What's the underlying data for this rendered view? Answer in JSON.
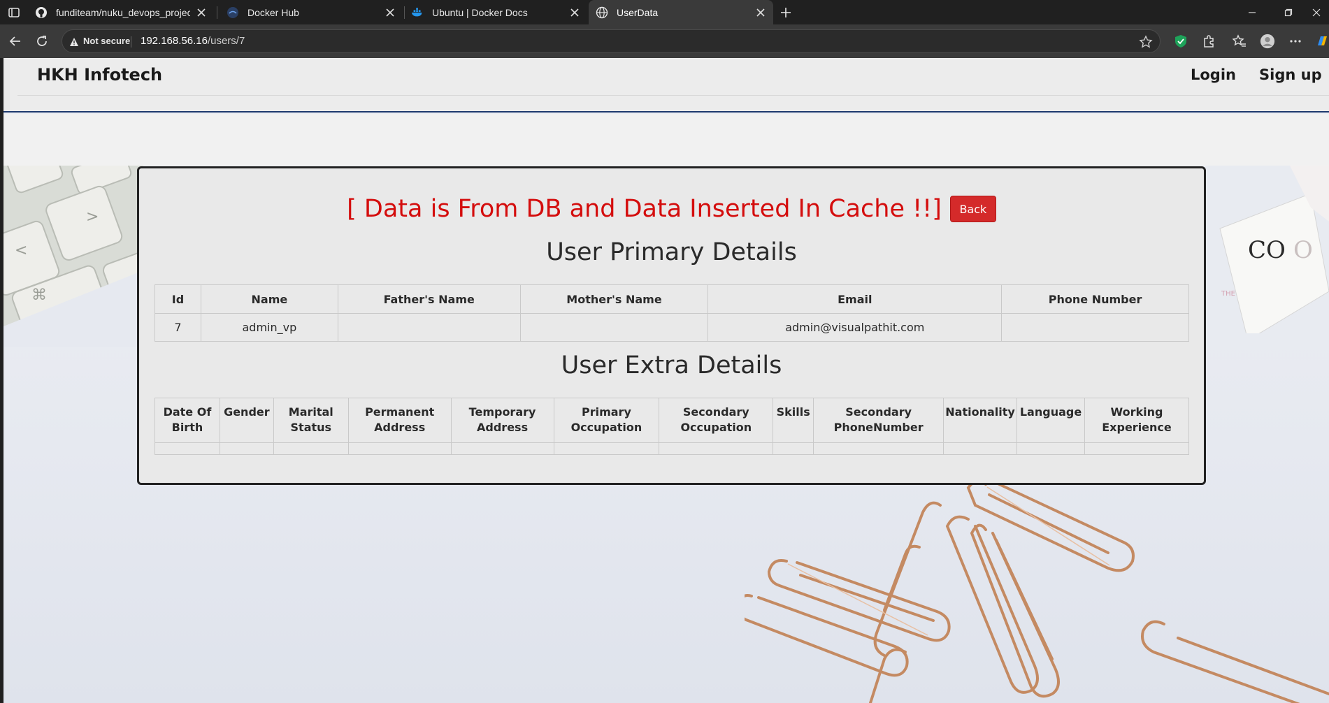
{
  "browser": {
    "tabs": [
      {
        "title": "funditeam/nuku_devops_projects",
        "icon": "github-icon",
        "active": false
      },
      {
        "title": "Docker Hub",
        "icon": "docker-hub-icon",
        "active": false
      },
      {
        "title": "Ubuntu | Docker Docs",
        "icon": "docker-icon",
        "active": false
      },
      {
        "title": "UserData",
        "icon": "globe-icon",
        "active": true
      }
    ],
    "security_label": "Not secure",
    "url_host": "192.168.56.16",
    "url_path": "/users/7"
  },
  "site": {
    "brand": "HKH Infotech",
    "nav": {
      "login": "Login",
      "signup": "Sign up"
    }
  },
  "card": {
    "banner": "[ Data is From DB and Data Inserted In Cache !!]",
    "back_label": "Back",
    "primary_title": "User Primary Details",
    "extra_title": "User Extra Details"
  },
  "primary_table": {
    "headers": [
      "Id",
      "Name",
      "Father's Name",
      "Mother's Name",
      "Email",
      "Phone Number"
    ],
    "rows": [
      [
        "7",
        "admin_vp",
        "",
        "",
        "admin@visualpathit.com",
        ""
      ]
    ]
  },
  "extra_table": {
    "headers": [
      [
        "Date Of",
        "Birth"
      ],
      [
        "Gender"
      ],
      [
        "Marital",
        "Status"
      ],
      [
        "Permanent",
        "Address"
      ],
      [
        "Temporary",
        "Address"
      ],
      [
        "Primary",
        "Occupation"
      ],
      [
        "Secondary",
        "Occupation"
      ],
      [
        "Skills"
      ],
      [
        "Secondary",
        "PhoneNumber"
      ],
      [
        "Nationality"
      ],
      [
        "Language"
      ],
      [
        "Working",
        "Experience"
      ]
    ],
    "rows": [
      [
        "",
        "",
        "",
        "",
        "",
        "",
        "",
        "",
        "",
        "",
        "",
        ""
      ]
    ]
  },
  "colors": {
    "banner": "#d40d0d",
    "back_button": "#d42a2a",
    "header_rule": "#1e3a6e"
  }
}
